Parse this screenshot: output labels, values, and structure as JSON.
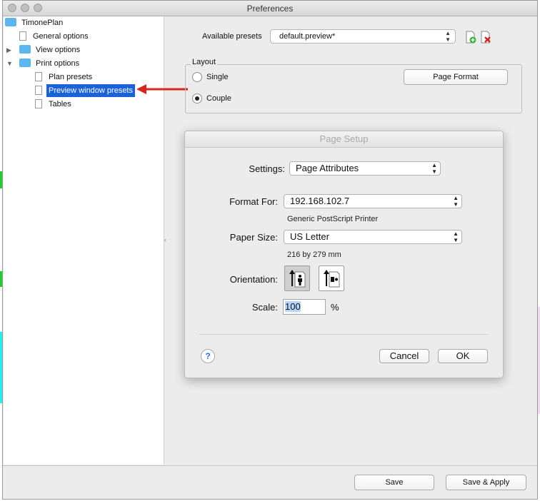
{
  "window": {
    "title": "Preferences"
  },
  "tree": {
    "root": "TimonePlan",
    "general": "General options",
    "view": "View options",
    "print": "Print options",
    "plan": "Plan presets",
    "preview": "Preview window presets",
    "tables": "Tables"
  },
  "presets": {
    "label": "Available presets",
    "value": "default.preview*"
  },
  "layout": {
    "legend": "Layout",
    "single": "Single",
    "couple": "Couple",
    "selected": "Couple",
    "page_format": "Page Format"
  },
  "dialog": {
    "title": "Page Setup",
    "settings_label": "Settings:",
    "settings_value": "Page Attributes",
    "format_label": "Format For:",
    "format_value": "192.168.102.7",
    "format_sub": "Generic PostScript Printer",
    "paper_label": "Paper Size:",
    "paper_value": "US Letter",
    "paper_sub": "216 by 279 mm",
    "orientation_label": "Orientation:",
    "orientation_selected": "portrait",
    "scale_label": "Scale:",
    "scale_value": "100",
    "scale_unit": "%",
    "help": "?",
    "cancel": "Cancel",
    "ok": "OK"
  },
  "footer": {
    "save": "Save",
    "save_apply": "Save & Apply"
  },
  "colors": {
    "selection": "#1a62d6",
    "annotation_arrow": "#d9261c",
    "folder": "#5eb6ef"
  }
}
